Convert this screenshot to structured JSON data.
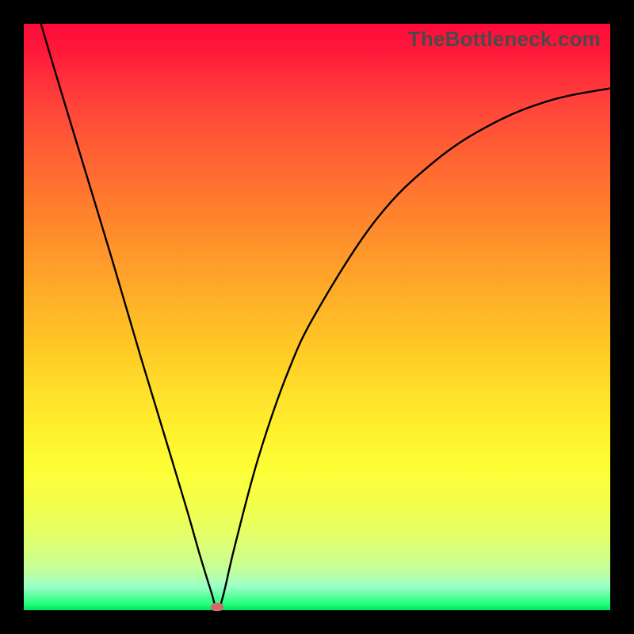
{
  "watermark": "TheBottleneck.com",
  "colors": {
    "frame": "#000000",
    "curve": "#000000",
    "marker": "#d46a6e",
    "gradient_top": "#ff0a3a",
    "gradient_bottom": "#00e060"
  },
  "chart_data": {
    "type": "line",
    "title": "",
    "xlabel": "",
    "ylabel": "",
    "xlim": [
      0,
      1
    ],
    "ylim": [
      0,
      1
    ],
    "annotations": [],
    "series": [
      {
        "name": "curve",
        "x": [
          0.0,
          0.05,
          0.1,
          0.15,
          0.2,
          0.25,
          0.28,
          0.3,
          0.32,
          0.33,
          0.34,
          0.36,
          0.4,
          0.45,
          0.5,
          0.6,
          0.7,
          0.8,
          0.9,
          1.0
        ],
        "values": [
          1.1,
          0.93,
          0.765,
          0.6,
          0.43,
          0.265,
          0.165,
          0.095,
          0.03,
          0.0,
          0.025,
          0.11,
          0.26,
          0.405,
          0.51,
          0.665,
          0.765,
          0.83,
          0.87,
          0.89
        ]
      }
    ],
    "marker": {
      "x": 0.33,
      "y": 0.0
    }
  }
}
